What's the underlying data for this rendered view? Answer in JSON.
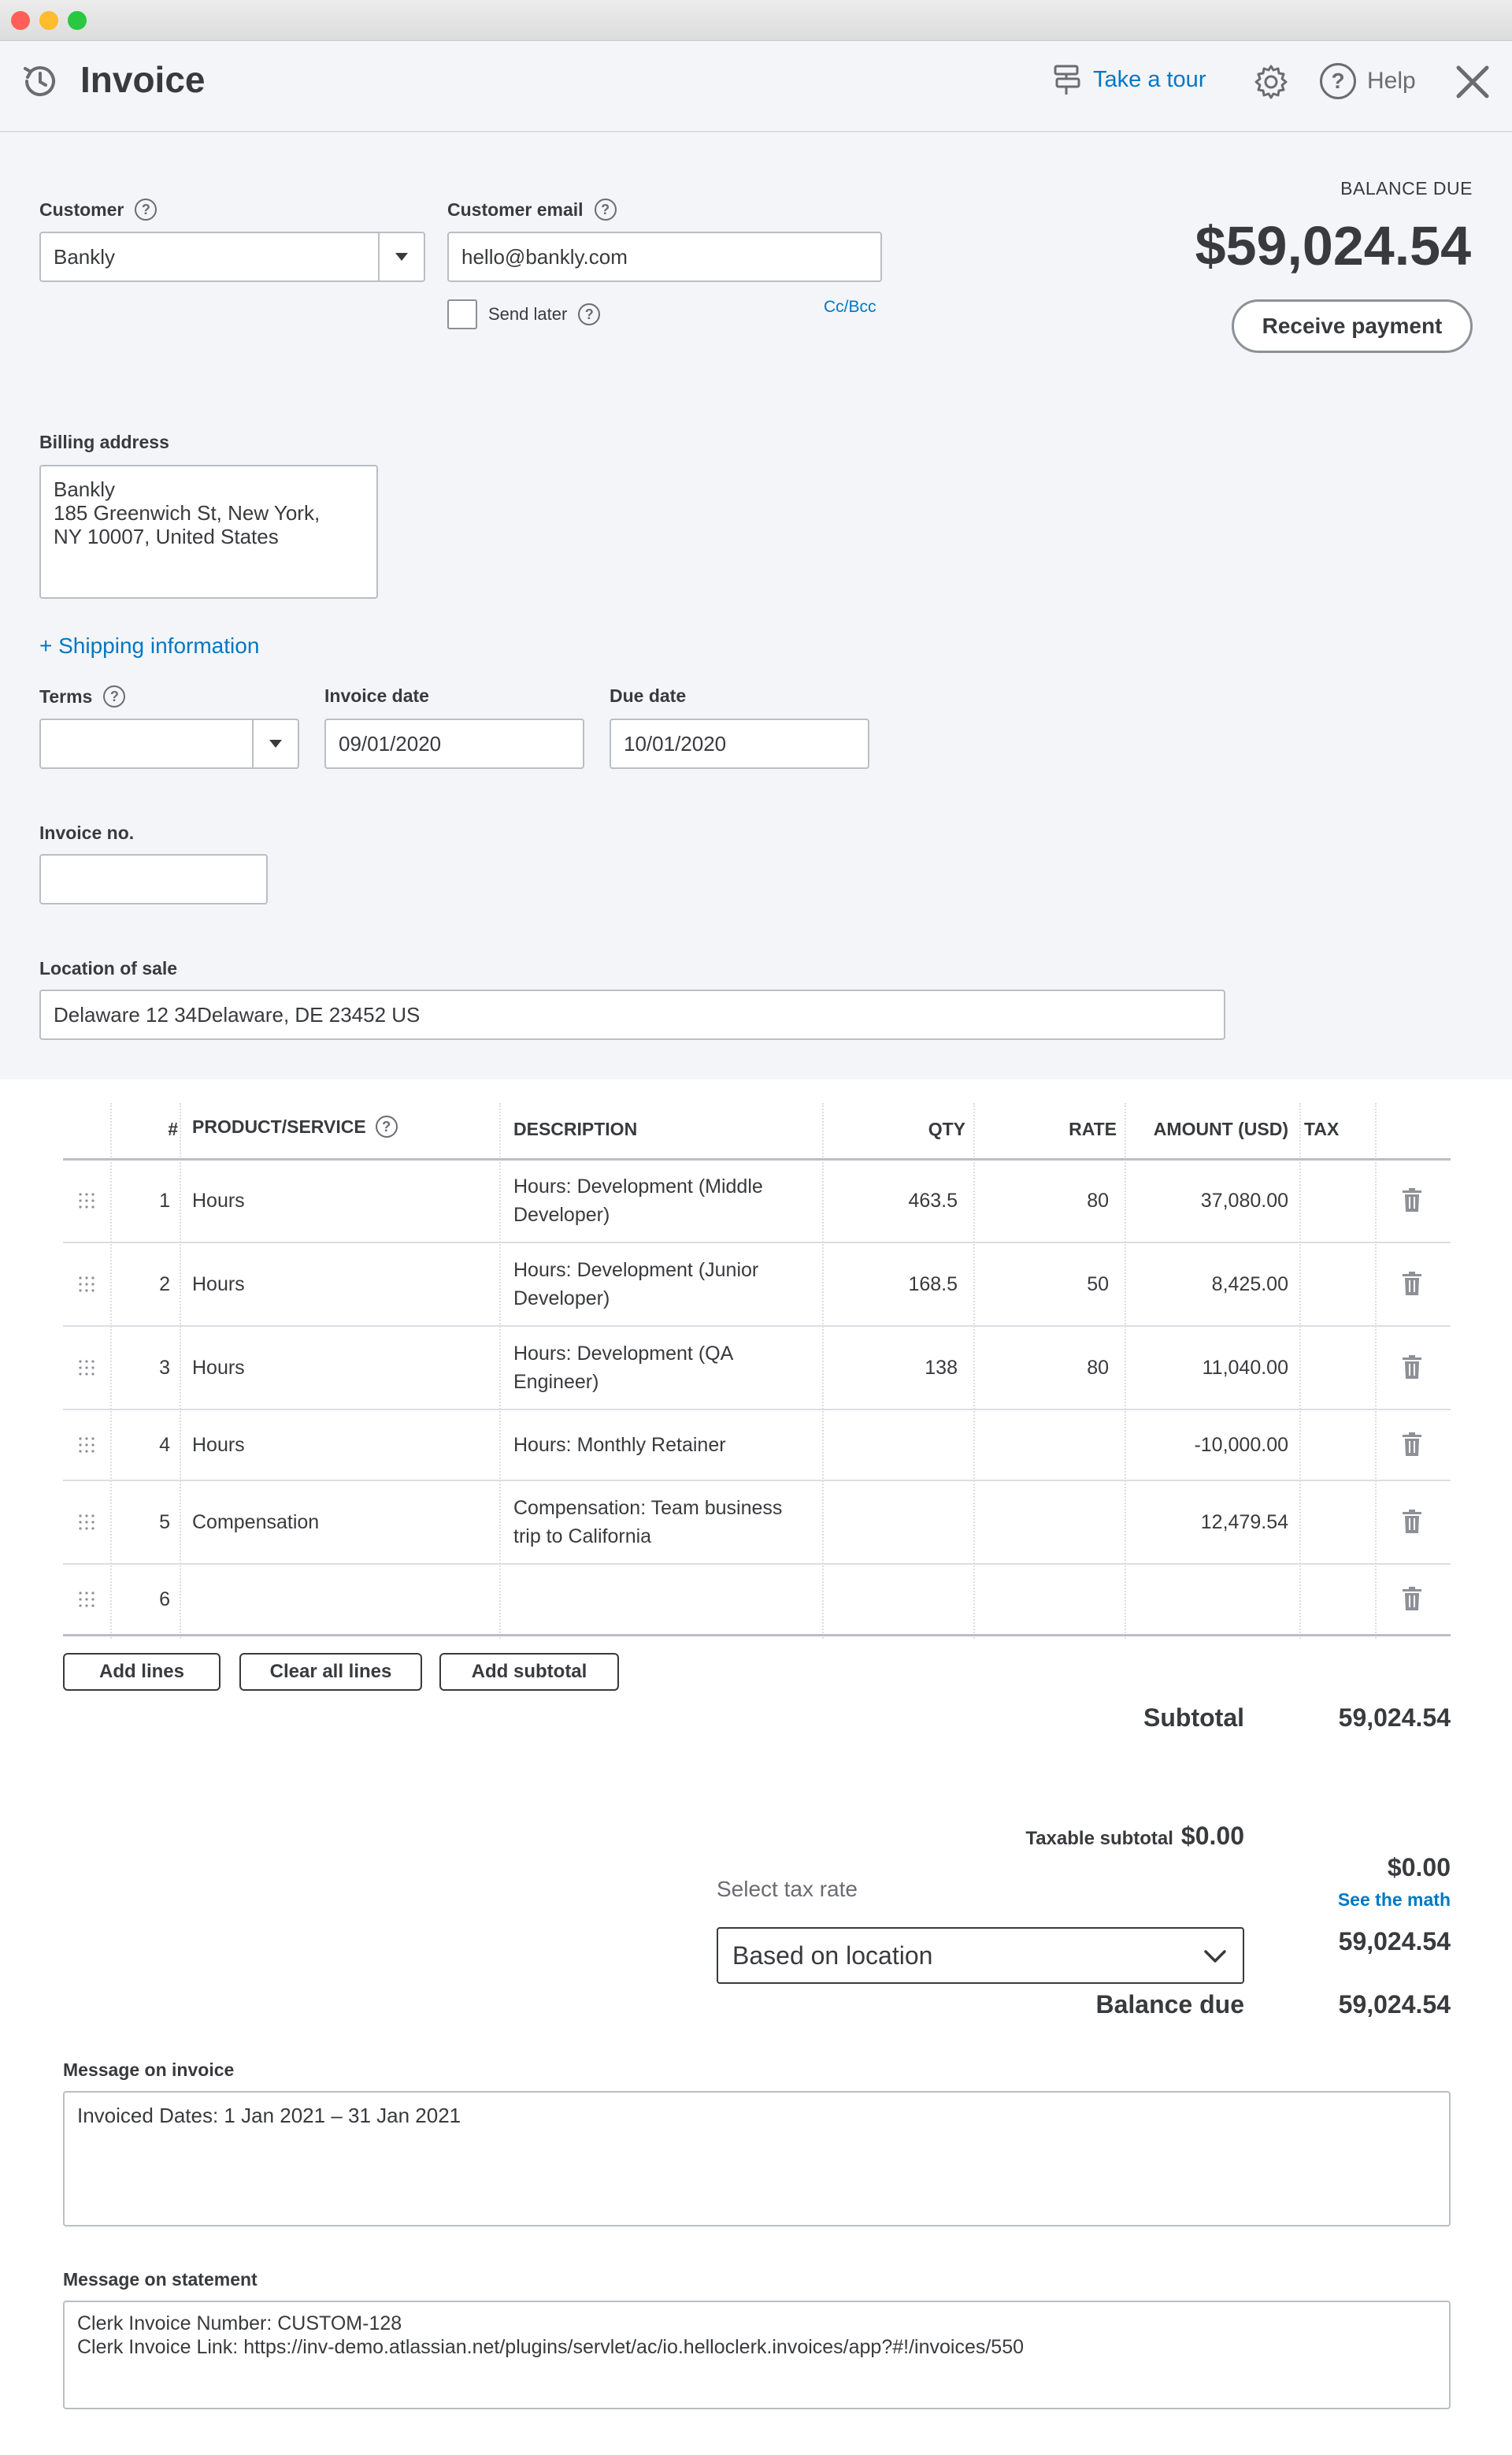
{
  "window": {
    "title": "Invoice"
  },
  "header": {
    "title": "Invoice",
    "take_tour": "Take a tour",
    "help": "Help"
  },
  "balance": {
    "label": "BALANCE DUE",
    "amount": "$59,024.54",
    "receive_payment": "Receive payment"
  },
  "customer": {
    "label": "Customer",
    "value": "Bankly"
  },
  "customer_email": {
    "label": "Customer email",
    "value": "hello@bankly.com",
    "send_later": "Send later",
    "cc_bcc": "Cc/Bcc"
  },
  "billing": {
    "label": "Billing address",
    "value": "Bankly\n185 Greenwich St, New York,\nNY 10007, United States"
  },
  "shipping_link": "+ Shipping information",
  "terms": {
    "label": "Terms",
    "value": ""
  },
  "invoice_date": {
    "label": "Invoice date",
    "value": "09/01/2020"
  },
  "due_date": {
    "label": "Due date",
    "value": "10/01/2020"
  },
  "invoice_no": {
    "label": "Invoice no.",
    "value": ""
  },
  "location": {
    "label": "Location of sale",
    "value": "Delaware 12 34Delaware, DE  23452 US"
  },
  "table": {
    "headers": {
      "num": "#",
      "product": "PRODUCT/SERVICE",
      "description": "DESCRIPTION",
      "qty": "QTY",
      "rate": "RATE",
      "amount": "AMOUNT (USD)",
      "tax": "TAX"
    },
    "rows": [
      {
        "num": "1",
        "product": "Hours",
        "desc1": "Hours: Development (Middle",
        "desc2": "Developer)",
        "qty": "463.5",
        "rate": "80",
        "amount": "37,080.00"
      },
      {
        "num": "2",
        "product": "Hours",
        "desc1": "Hours: Development (Junior",
        "desc2": "Developer)",
        "qty": "168.5",
        "rate": "50",
        "amount": "8,425.00"
      },
      {
        "num": "3",
        "product": "Hours",
        "desc1": "Hours: Development (QA",
        "desc2": "Engineer)",
        "qty": "138",
        "rate": "80",
        "amount": "11,040.00"
      },
      {
        "num": "4",
        "product": "Hours",
        "desc1": "Hours: Monthly Retainer",
        "desc2": "",
        "qty": "",
        "rate": "",
        "amount": "-10,000.00"
      },
      {
        "num": "5",
        "product": "Compensation",
        "desc1": "Compensation: Team business",
        "desc2": "trip to California",
        "qty": "",
        "rate": "",
        "amount": "12,479.54"
      },
      {
        "num": "6",
        "product": "",
        "desc1": "",
        "desc2": "",
        "qty": "",
        "rate": "",
        "amount": ""
      }
    ]
  },
  "buttons": {
    "add_lines": "Add lines",
    "clear_all": "Clear all lines",
    "add_subtotal": "Add subtotal"
  },
  "totals": {
    "subtotal_label": "Subtotal",
    "subtotal_value": "59,024.54",
    "taxable_label": "Taxable subtotal",
    "taxable_value": "$0.00",
    "select_tax_label": "Select tax rate",
    "tax_rate_value": "Based on location",
    "tax_amount": "$0.00",
    "see_math": "See the math",
    "total_value": "59,024.54",
    "balance_label": "Balance due",
    "balance_value": "59,024.54"
  },
  "message_invoice": {
    "label": "Message on invoice",
    "value": "Invoiced Dates: 1 Jan 2021 – 31 Jan 2021"
  },
  "message_statement": {
    "label": "Message on statement",
    "value": "Clerk Invoice Number: CUSTOM-128\nClerk Invoice Link: https://inv-demo.atlassian.net/plugins/servlet/ac/io.helloclerk.invoices/app?#!/invoices/550"
  }
}
